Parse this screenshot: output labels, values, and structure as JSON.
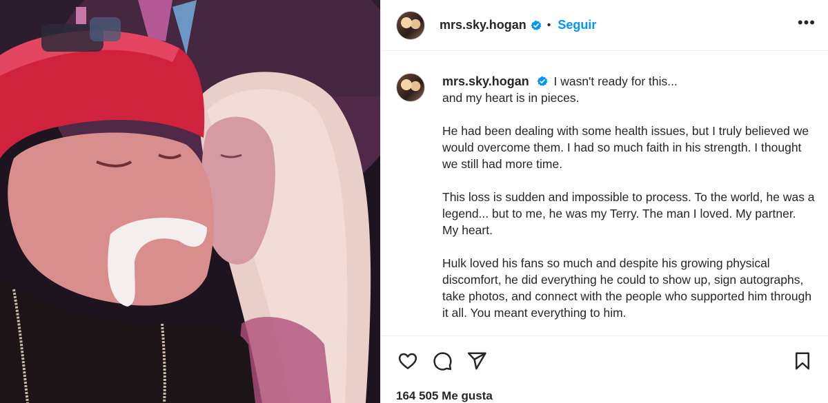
{
  "header": {
    "username": "mrs.sky.hogan",
    "separator": "•",
    "follow_label": "Seguir",
    "more_label": "•••"
  },
  "caption": {
    "username": "mrs.sky.hogan",
    "line1": "I wasn't ready for this...",
    "line2": "and my heart is in pieces.",
    "p2": "He had been dealing with some health issues, but I truly believed we would overcome them. I had so much faith in his strength. I thought we still had more time.",
    "p3": "This loss is sudden and impossible to process. To the world, he was a legend... but to me, he was my Terry. The man I loved. My partner. My heart.",
    "p4": "Hulk loved his fans so much and despite his growing physical discomfort, he did everything he could to show up, sign autographs, take photos, and connect with the people who supported him through it all. You meant everything to him."
  },
  "actions": {
    "like_icon": "heart-icon",
    "comment_icon": "comment-icon",
    "share_icon": "send-icon",
    "save_icon": "bookmark-icon"
  },
  "likes_text": "164 505 Me gusta",
  "colors": {
    "accent": "#0095f6",
    "text": "#262626",
    "border": "#efefef"
  }
}
